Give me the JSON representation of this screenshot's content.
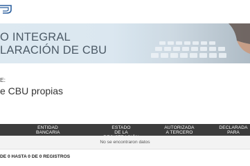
{
  "header": {
    "logo_icon": "bank-logo-icon"
  },
  "banner": {
    "title_line1": "O INTEGRAL",
    "title_line2": "LARACIÓN DE CBU",
    "image_icon": "keyboard-hand-photo"
  },
  "content": {
    "label": "E:",
    "section_title": "e CBU propias"
  },
  "table": {
    "columns": [
      {
        "line1": "ENTIDAD",
        "line2": "BANCARIA"
      },
      {
        "line1": "ESTADO",
        "line2": "DE LA REGISTRACIÓN"
      },
      {
        "line1": "AUTORIZADA",
        "line2": "A TERCERO"
      },
      {
        "line1": "DECLARADA",
        "line2": "PARA"
      }
    ],
    "empty_message": "No se encontraron datos",
    "info": "DE 0 HASTA 0 DE 0 REGISTROS"
  },
  "colors": {
    "header_bg": "#3c3c3c",
    "banner_text": "#4c5a66",
    "logo_blue": "#2b5f9e"
  }
}
